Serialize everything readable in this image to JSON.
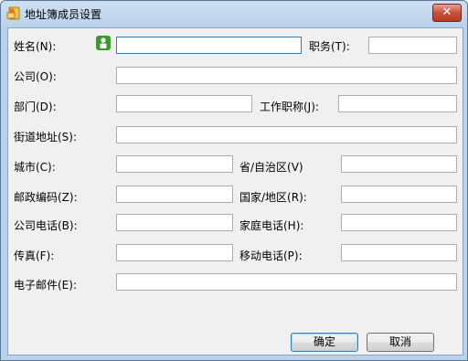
{
  "window": {
    "title": "地址簿成员设置",
    "close_label": "✕"
  },
  "form": {
    "name_label": "姓名(N):",
    "title_label": "职务(T):",
    "company_label": "公司(O):",
    "department_label": "部门(D):",
    "job_title_label": "工作职称(J):",
    "street_label": "街道地址(S):",
    "city_label": "城市(C):",
    "province_label": "省/自治区(V)",
    "postal_label": "邮政编码(Z):",
    "country_label": "国家/地区(R):",
    "company_phone_label": "公司电话(B):",
    "home_phone_label": "家庭电话(H):",
    "fax_label": "传真(F):",
    "mobile_label": "移动电话(P):",
    "email_label": "电子邮件(E):",
    "name_value": "",
    "title_value": "",
    "company_value": "",
    "department_value": "",
    "job_title_value": "",
    "street_value": "",
    "city_value": "",
    "province_value": "",
    "postal_value": "",
    "country_value": "",
    "company_phone_value": "",
    "home_phone_value": "",
    "fax_value": "",
    "mobile_value": "",
    "email_value": ""
  },
  "buttons": {
    "ok_label": "确定",
    "cancel_label": "取消"
  },
  "icons": {
    "title_icon": "address-book-icon",
    "contact_icon": "contact-person-icon"
  }
}
